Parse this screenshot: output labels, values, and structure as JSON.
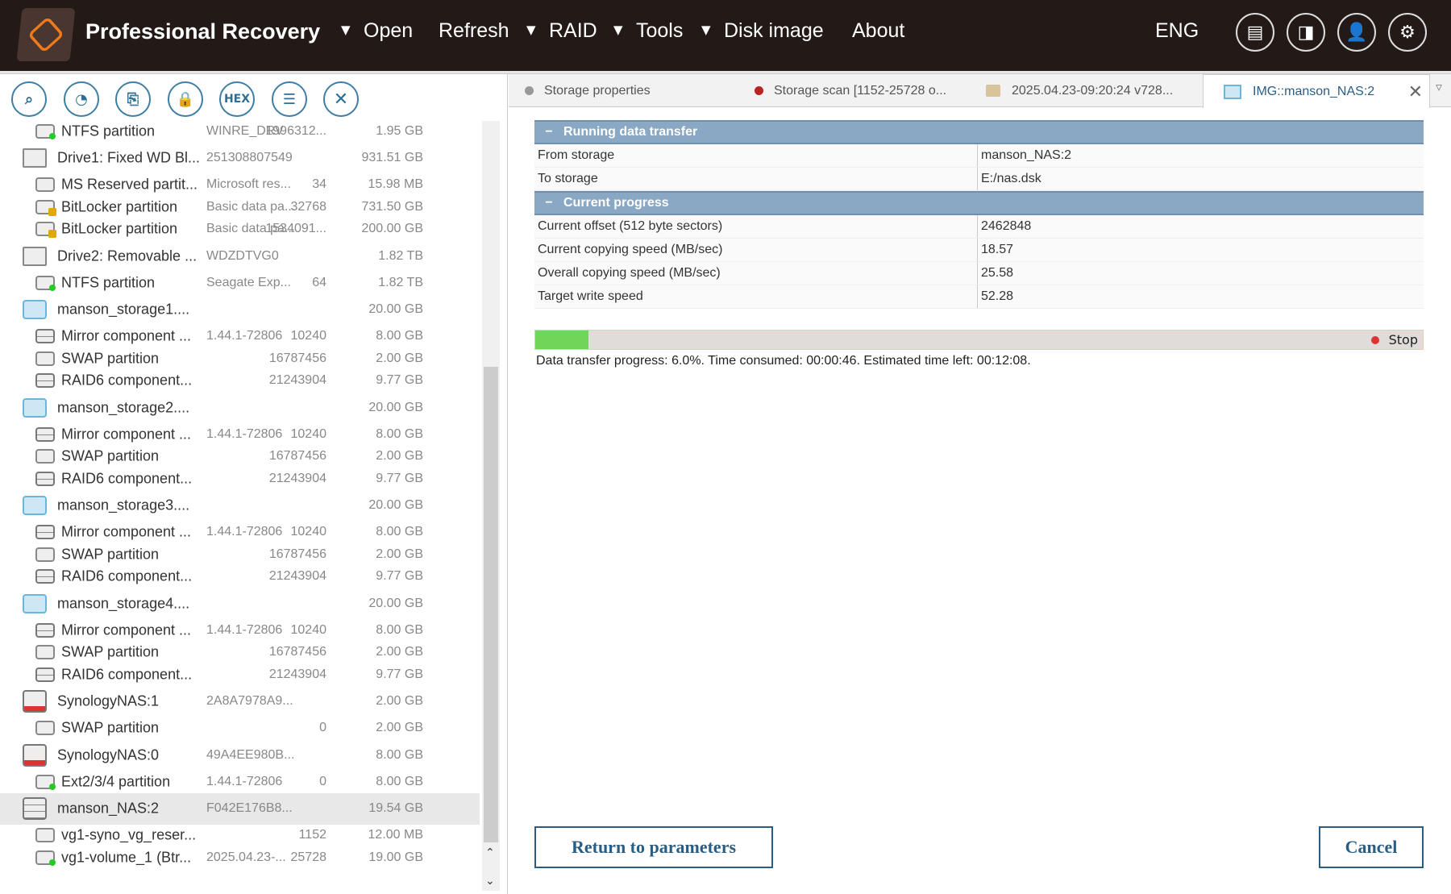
{
  "app": {
    "title": "Professional Recovery",
    "menu": [
      "Open",
      "Refresh",
      "RAID",
      "Tools",
      "Disk image",
      "About"
    ],
    "lang": "ENG"
  },
  "toolbar": {
    "hex": "HEX"
  },
  "tree": [
    {
      "level": "child",
      "icon": "disk-green",
      "name": "NTFS partition",
      "c2": "WINRE_DRV",
      "c3": "1996312...",
      "c4": "1.95 GB"
    },
    {
      "level": "parent",
      "icon": "drive",
      "name": "Drive1: Fixed WD Bl...",
      "c2": "251308807549",
      "c3": "",
      "c4": "931.51 GB"
    },
    {
      "level": "child",
      "icon": "disk",
      "name": "MS Reserved partit...",
      "c2": "Microsoft res...",
      "c3": "34",
      "c4": "15.98 MB"
    },
    {
      "level": "child",
      "icon": "disk-lock",
      "name": "BitLocker partition",
      "c2": "Basic data pa...",
      "c3": "32768",
      "c4": "731.50 GB"
    },
    {
      "level": "child",
      "icon": "disk-lock",
      "name": "BitLocker partition",
      "c2": "Basic data pa...",
      "c3": "1534091...",
      "c4": "200.00 GB"
    },
    {
      "level": "parent",
      "icon": "drive",
      "name": "Drive2: Removable ...",
      "c2": "WDZDTVG0",
      "c3": "",
      "c4": "1.82 TB"
    },
    {
      "level": "child",
      "icon": "disk-green",
      "name": "NTFS partition",
      "c2": "Seagate Exp...",
      "c3": "64",
      "c4": "1.82 TB"
    },
    {
      "level": "parent",
      "icon": "img",
      "name": "manson_storage1....",
      "c2": "",
      "c3": "",
      "c4": "20.00 GB"
    },
    {
      "level": "child",
      "icon": "raid",
      "name": "Mirror component ...",
      "c2": "1.44.1-72806",
      "c3": "10240",
      "c4": "8.00 GB"
    },
    {
      "level": "child",
      "icon": "swap",
      "name": "SWAP partition",
      "c2": "",
      "c3": "16787456",
      "c4": "2.00 GB"
    },
    {
      "level": "child",
      "icon": "raid",
      "name": "RAID6 component...",
      "c2": "",
      "c3": "21243904",
      "c4": "9.77 GB"
    },
    {
      "level": "parent",
      "icon": "img",
      "name": "manson_storage2....",
      "c2": "",
      "c3": "",
      "c4": "20.00 GB"
    },
    {
      "level": "child",
      "icon": "raid",
      "name": "Mirror component ...",
      "c2": "1.44.1-72806",
      "c3": "10240",
      "c4": "8.00 GB"
    },
    {
      "level": "child",
      "icon": "swap",
      "name": "SWAP partition",
      "c2": "",
      "c3": "16787456",
      "c4": "2.00 GB"
    },
    {
      "level": "child",
      "icon": "raid",
      "name": "RAID6 component...",
      "c2": "",
      "c3": "21243904",
      "c4": "9.77 GB"
    },
    {
      "level": "parent",
      "icon": "img",
      "name": "manson_storage3....",
      "c2": "",
      "c3": "",
      "c4": "20.00 GB"
    },
    {
      "level": "child",
      "icon": "raid",
      "name": "Mirror component ...",
      "c2": "1.44.1-72806",
      "c3": "10240",
      "c4": "8.00 GB"
    },
    {
      "level": "child",
      "icon": "swap",
      "name": "SWAP partition",
      "c2": "",
      "c3": "16787456",
      "c4": "2.00 GB"
    },
    {
      "level": "child",
      "icon": "raid",
      "name": "RAID6 component...",
      "c2": "",
      "c3": "21243904",
      "c4": "9.77 GB"
    },
    {
      "level": "parent",
      "icon": "img",
      "name": "manson_storage4....",
      "c2": "",
      "c3": "",
      "c4": "20.00 GB"
    },
    {
      "level": "child",
      "icon": "raid",
      "name": "Mirror component ...",
      "c2": "1.44.1-72806",
      "c3": "10240",
      "c4": "8.00 GB"
    },
    {
      "level": "child",
      "icon": "swap",
      "name": "SWAP partition",
      "c2": "",
      "c3": "16787456",
      "c4": "2.00 GB"
    },
    {
      "level": "child",
      "icon": "raid",
      "name": "RAID6 component...",
      "c2": "",
      "c3": "21243904",
      "c4": "9.77 GB"
    },
    {
      "level": "parent",
      "icon": "nas-red",
      "name": "SynologyNAS:1",
      "c2": "2A8A7978A9...",
      "c3": "",
      "c4": "2.00 GB"
    },
    {
      "level": "child",
      "icon": "swap",
      "name": "SWAP partition",
      "c2": "",
      "c3": "0",
      "c4": "2.00 GB"
    },
    {
      "level": "parent",
      "icon": "nas-red",
      "name": "SynologyNAS:0",
      "c2": "49A4EE980B...",
      "c3": "",
      "c4": "8.00 GB"
    },
    {
      "level": "child",
      "icon": "disk-green",
      "name": "Ext2/3/4 partition",
      "c2": "1.44.1-72806",
      "c3": "0",
      "c4": "8.00 GB"
    },
    {
      "level": "parent",
      "icon": "nas",
      "name": "manson_NAS:2",
      "c2": "F042E176B8...",
      "c3": "",
      "c4": "19.54 GB",
      "selected": true
    },
    {
      "level": "child",
      "icon": "disk",
      "name": "vg1-syno_vg_reser...",
      "c2": "",
      "c3": "1152",
      "c4": "12.00 MB"
    },
    {
      "level": "child",
      "icon": "disk-green",
      "name": "vg1-volume_1 (Btr...",
      "c2": "2025.04.23-...",
      "c3": "25728",
      "c4": "19.00 GB"
    }
  ],
  "tabs": [
    "Storage properties",
    "Storage scan [1152-25728 o...",
    "2025.04.23-09:20:24 v728...",
    "IMG::manson_NAS:2"
  ],
  "transfer": {
    "section1": "Running data transfer",
    "rows1": [
      {
        "k": "From storage",
        "v": "manson_NAS:2"
      },
      {
        "k": "To storage",
        "v": "E:/nas.dsk"
      }
    ],
    "section2": "Current progress",
    "rows2": [
      {
        "k": "Current offset (512 byte sectors)",
        "v": "2462848"
      },
      {
        "k": "Current copying speed (MB/sec)",
        "v": "18.57"
      },
      {
        "k": "Overall copying speed (MB/sec)",
        "v": "25.58"
      },
      {
        "k": "Target write speed",
        "v": "52.28"
      }
    ],
    "progress_percent": 6.0,
    "stop": "Stop",
    "status": "Data transfer progress: 6.0%. Time consumed: 00:00:46. Estimated time left: 00:12:08."
  },
  "buttons": {
    "return": "Return to parameters",
    "cancel": "Cancel"
  }
}
